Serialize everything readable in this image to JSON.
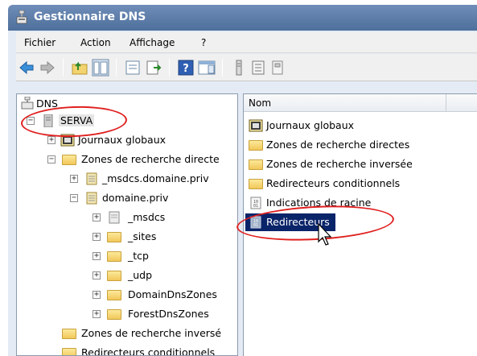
{
  "window": {
    "title": "Gestionnaire DNS"
  },
  "menu": [
    {
      "label": "Fichier"
    },
    {
      "label": "Action"
    },
    {
      "label": "Affichage"
    },
    {
      "label": "?"
    }
  ],
  "toolbar": {
    "icons": [
      "back-icon",
      "forward-icon",
      "up-folder-icon",
      "show-hide-tree-icon",
      "properties-icon",
      "export-icon",
      "help-icon",
      "show-hide-action-pane-icon",
      "server-icon",
      "zone-icon",
      "record-icon"
    ]
  },
  "tree": {
    "root": "DNS",
    "server": "SERVA",
    "items": [
      {
        "label": "Journaux globaux"
      },
      {
        "label": "Zones de recherche directe"
      },
      {
        "label": "_msdcs.domaine.priv"
      },
      {
        "label": "domaine.priv"
      },
      {
        "label": "_msdcs"
      },
      {
        "label": "_sites"
      },
      {
        "label": "_tcp"
      },
      {
        "label": "_udp"
      },
      {
        "label": "DomainDnsZones"
      },
      {
        "label": "ForestDnsZones"
      },
      {
        "label": "Zones de recherche inversé"
      },
      {
        "label": "Redirecteurs conditionnels"
      }
    ]
  },
  "list": {
    "header": "Nom",
    "items": [
      {
        "label": "Journaux globaux"
      },
      {
        "label": "Zones de recherche directes"
      },
      {
        "label": "Zones de recherche inversée"
      },
      {
        "label": "Redirecteurs conditionnels"
      },
      {
        "label": "Indications de racine"
      },
      {
        "label": "Redirecteurs"
      }
    ]
  },
  "colors": {
    "titlebar": "#5a7aa8",
    "selection": "#0a246a",
    "annotation": "#e02020"
  }
}
